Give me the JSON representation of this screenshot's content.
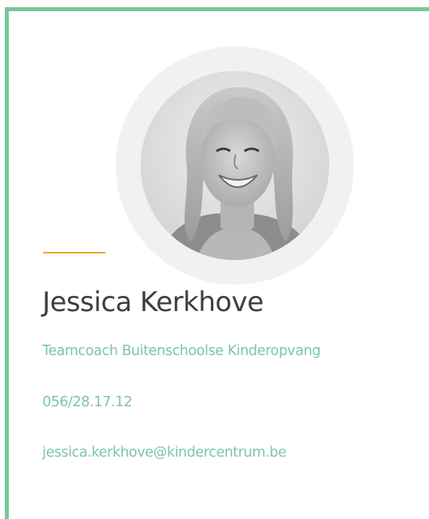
{
  "profile": {
    "name": "Jessica Kerkhove",
    "role": "Teamcoach Buitenschoolse Kinderopvang",
    "phone": "056/28.17.12",
    "email": "jessica.kerkhove@kindercentrum.be",
    "photo_icon": "portrait-photo"
  },
  "colors": {
    "border": "#79c79c",
    "accent_line": "#f5a623",
    "name_text": "#3e3e3e",
    "detail_text": "#7cc7a2",
    "ring": "#f1f1f1"
  }
}
